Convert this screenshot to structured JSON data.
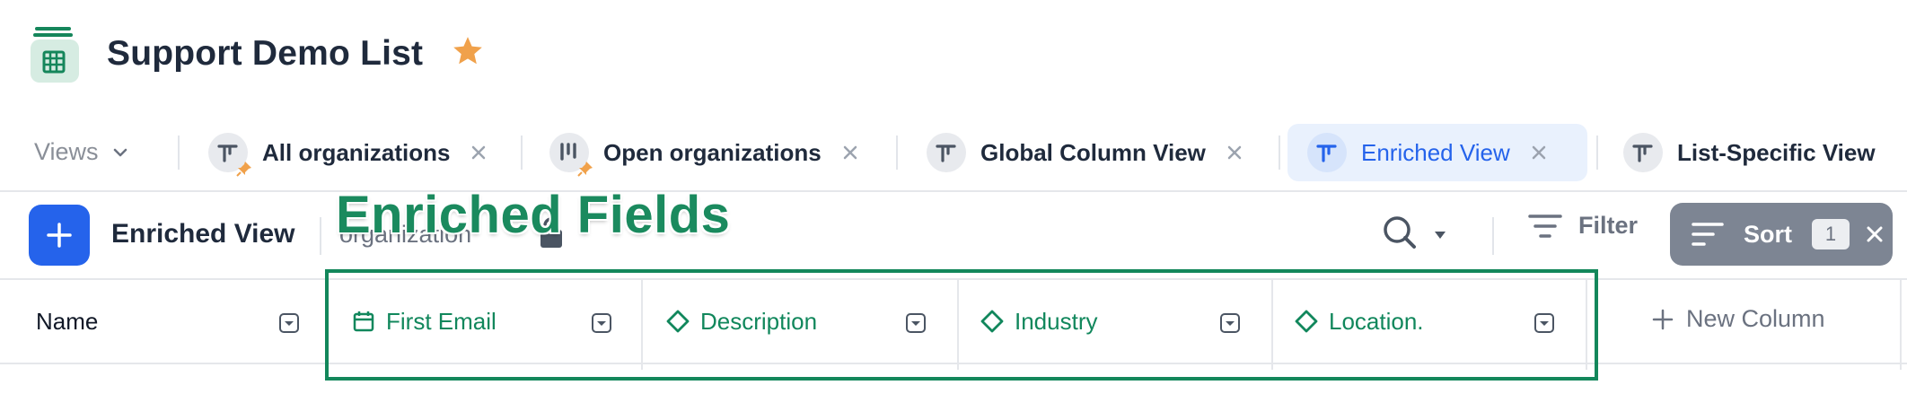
{
  "header": {
    "title": "Support Demo List",
    "app_icon": "building-list-icon",
    "favorite_icon": "star-icon",
    "colors": {
      "star": "#f0a14b",
      "app_icon_bg": "#d6ece2",
      "app_icon_fg": "#15865b"
    }
  },
  "views_bar": {
    "label": "Views",
    "tabs": [
      {
        "label": "All organizations",
        "icon": "column-view-icon",
        "pinned": true,
        "active": false
      },
      {
        "label": "Open organizations",
        "icon": "board-view-icon",
        "pinned": true,
        "active": false
      },
      {
        "label": "Global Column View",
        "icon": "column-view-icon",
        "pinned": false,
        "active": false
      },
      {
        "label": "Enriched View",
        "icon": "column-view-icon",
        "pinned": false,
        "active": true
      },
      {
        "label": "List-Specific View",
        "icon": "column-view-icon",
        "pinned": false,
        "active": false
      }
    ]
  },
  "toolbar": {
    "view_name": "Enriched View",
    "object_label": "organization",
    "filter_label": "Filter",
    "sort_label": "Sort",
    "sort_count": "1",
    "colors": {
      "add_button": "#2563eb",
      "sort_button": "#7d8593"
    }
  },
  "annotation": {
    "label": "Enriched Fields",
    "color": "#13875b"
  },
  "table": {
    "columns": [
      {
        "label": "Name",
        "icon": "",
        "enriched": false
      },
      {
        "label": "First Email",
        "icon": "calendar-icon",
        "enriched": true
      },
      {
        "label": "Description",
        "icon": "diamond-icon",
        "enriched": true
      },
      {
        "label": "Industry",
        "icon": "diamond-icon",
        "enriched": true
      },
      {
        "label": "Location.",
        "icon": "diamond-icon",
        "enriched": true
      }
    ],
    "new_column_label": "New Column"
  }
}
